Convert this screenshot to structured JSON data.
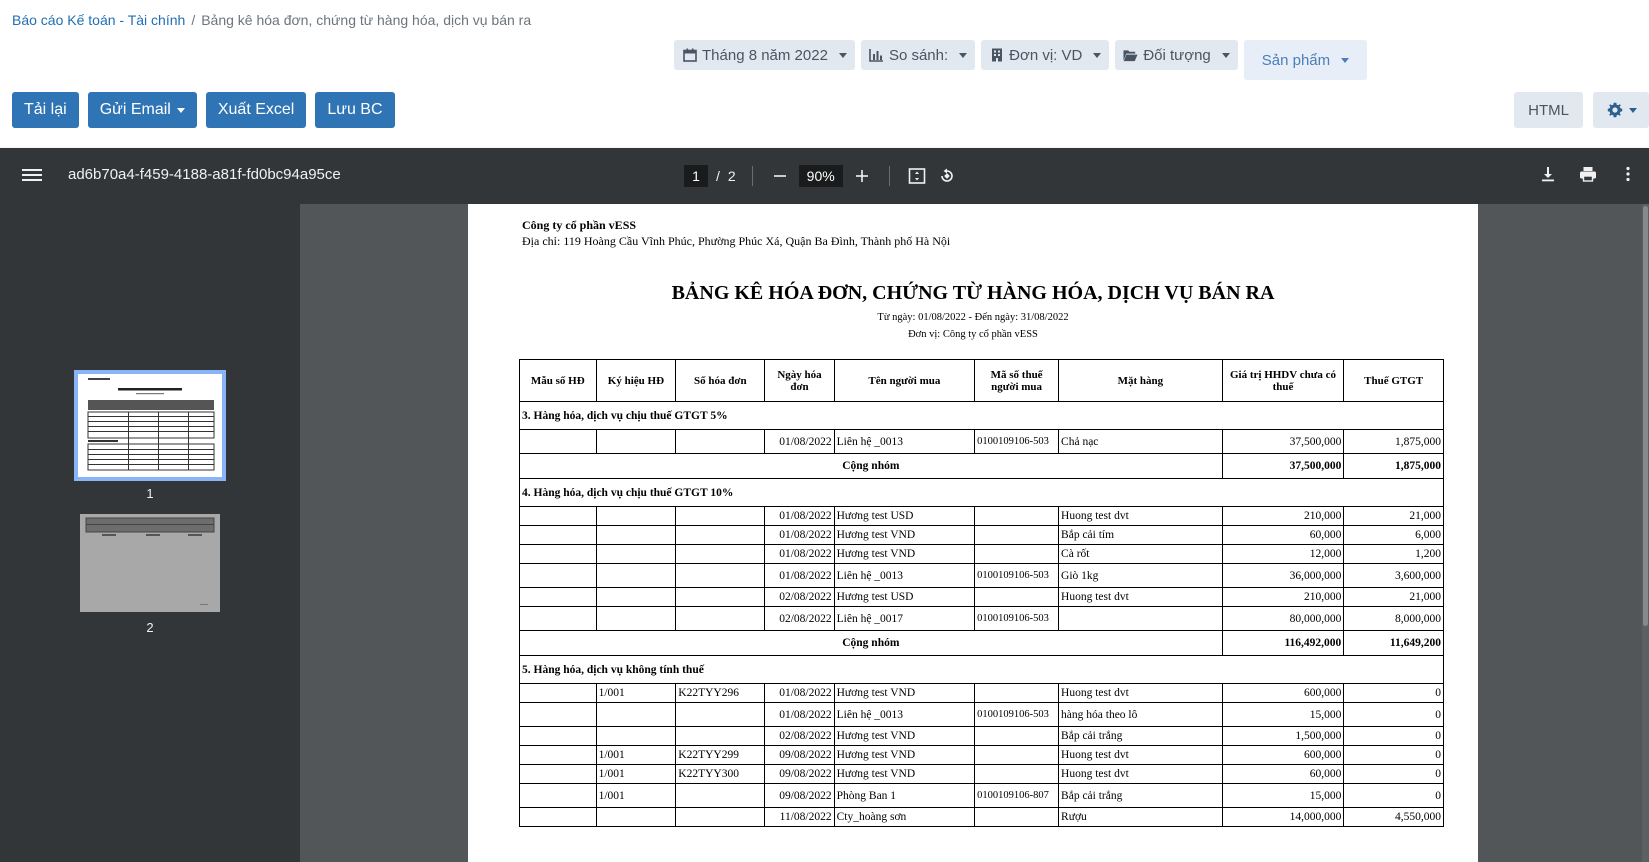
{
  "breadcrumb": {
    "parent": "Báo cáo Kế toán - Tài chính",
    "separator": "/",
    "current": "Bảng kê hóa đơn, chứng từ hàng hóa, dịch vụ bán ra"
  },
  "filters": {
    "period": "Tháng 8 năm 2022",
    "compare": "So sánh:",
    "unit": "Đơn vị: VD",
    "object": "Đối tượng",
    "product": "Sản phẩm"
  },
  "actions": {
    "reload": "Tải lại",
    "send_email": "Gửi Email",
    "export_excel": "Xuất Excel",
    "save": "Lưu BC",
    "html": "HTML"
  },
  "viewer": {
    "file_name": "ad6b70a4-f459-4188-a81f-fd0bc94a95ce",
    "current_page": "1",
    "page_sep": "/",
    "total_pages": "2",
    "zoom": "90%",
    "thumb_labels": [
      "1",
      "2"
    ]
  },
  "report": {
    "company": "Công ty cổ phần vESS",
    "address": "Địa chỉ: 119 Hoàng Cầu Vĩnh Phúc, Phường Phúc Xá, Quận Ba Đình, Thành phố Hà Nội",
    "title": "BẢNG KÊ HÓA ĐƠN, CHỨNG TỪ HÀNG HÓA, DỊCH VỤ BÁN RA",
    "date_range": "Từ ngày: 01/08/2022 - Đến ngày: 31/08/2022",
    "unit": "Đơn vị: Công ty cổ phần vESS",
    "columns": [
      "Mẫu số HĐ",
      "Ký hiệu HĐ",
      "Số hóa đơn",
      "Ngày hóa đơn",
      "Tên người mua",
      "Mã số thuế người mua",
      "Mặt hàng",
      "Giá trị HHDV chưa có thuế",
      "Thuế GTGT"
    ],
    "sections": [
      {
        "title": "3. Hàng hóa, dịch vụ chịu thuế GTGT 5%",
        "rows": [
          {
            "form": "",
            "symbol": "",
            "no": "",
            "date": "01/08/2022",
            "buyer": "Liên hệ _0013",
            "tax_code": "0100109106-503",
            "item": "Chả nạc",
            "value": "37,500,000",
            "vat": "1,875,000"
          }
        ],
        "total_label": "Cộng nhóm",
        "total_value": "37,500,000",
        "total_vat": "1,875,000"
      },
      {
        "title": "4. Hàng hóa, dịch vụ chịu thuế GTGT 10%",
        "rows": [
          {
            "form": "",
            "symbol": "",
            "no": "",
            "date": "01/08/2022",
            "buyer": "Hương test USD",
            "tax_code": "",
            "item": "Huong test dvt",
            "value": "210,000",
            "vat": "21,000"
          },
          {
            "form": "",
            "symbol": "",
            "no": "",
            "date": "01/08/2022",
            "buyer": "Hương test VND",
            "tax_code": "",
            "item": "Bắp cải tím",
            "value": "60,000",
            "vat": "6,000"
          },
          {
            "form": "",
            "symbol": "",
            "no": "",
            "date": "01/08/2022",
            "buyer": "Hương test VND",
            "tax_code": "",
            "item": "Cà rốt",
            "value": "12,000",
            "vat": "1,200"
          },
          {
            "form": "",
            "symbol": "",
            "no": "",
            "date": "01/08/2022",
            "buyer": "Liên hệ _0013",
            "tax_code": "0100109106-503",
            "item": "Giò 1kg",
            "value": "36,000,000",
            "vat": "3,600,000"
          },
          {
            "form": "",
            "symbol": "",
            "no": "",
            "date": "02/08/2022",
            "buyer": "Hương test USD",
            "tax_code": "",
            "item": "Huong test dvt",
            "value": "210,000",
            "vat": "21,000"
          },
          {
            "form": "",
            "symbol": "",
            "no": "",
            "date": "02/08/2022",
            "buyer": "Liên hệ _0017",
            "tax_code": "0100109106-503",
            "item": "",
            "value": "80,000,000",
            "vat": "8,000,000"
          }
        ],
        "total_label": "Cộng nhóm",
        "total_value": "116,492,000",
        "total_vat": "11,649,200"
      },
      {
        "title": "5. Hàng hóa, dịch vụ không tính thuế",
        "rows": [
          {
            "form": "",
            "symbol": "1/001",
            "no": "K22TYY296",
            "date": "01/08/2022",
            "buyer": "Hương test VND",
            "tax_code": "",
            "item": "Huong test dvt",
            "value": "600,000",
            "vat": "0"
          },
          {
            "form": "",
            "symbol": "",
            "no": "",
            "date": "01/08/2022",
            "buyer": "Liên hệ _0013",
            "tax_code": "0100109106-503",
            "item": "hàng hóa theo lô",
            "value": "15,000",
            "vat": "0"
          },
          {
            "form": "",
            "symbol": "",
            "no": "",
            "date": "02/08/2022",
            "buyer": "Hương test VND",
            "tax_code": "",
            "item": "Bắp cải trắng",
            "value": "1,500,000",
            "vat": "0"
          },
          {
            "form": "",
            "symbol": "1/001",
            "no": "K22TYY299",
            "date": "09/08/2022",
            "buyer": "Hương test VND",
            "tax_code": "",
            "item": "Huong test dvt",
            "value": "600,000",
            "vat": "0"
          },
          {
            "form": "",
            "symbol": "1/001",
            "no": "K22TYY300",
            "date": "09/08/2022",
            "buyer": "Hương test VND",
            "tax_code": "",
            "item": "Huong test dvt",
            "value": "60,000",
            "vat": "0"
          },
          {
            "form": "",
            "symbol": "1/001",
            "no": "",
            "date": "09/08/2022",
            "buyer": "Phòng Ban 1",
            "tax_code": "0100109106-807",
            "item": "Bắp cải trắng",
            "value": "15,000",
            "vat": "0"
          },
          {
            "form": "",
            "symbol": "",
            "no": "",
            "date": "11/08/2022",
            "buyer": "Cty_hoàng sơn",
            "tax_code": "",
            "item": "Rượu",
            "value": "14,000,000",
            "vat": "4,550,000"
          }
        ]
      }
    ]
  },
  "colors": {
    "primary": "#2f74b5",
    "link": "#1f6fb2",
    "toolbar": "#323639",
    "viewer_bg": "#525659",
    "thumb_highlight": "#8ab4f8"
  }
}
